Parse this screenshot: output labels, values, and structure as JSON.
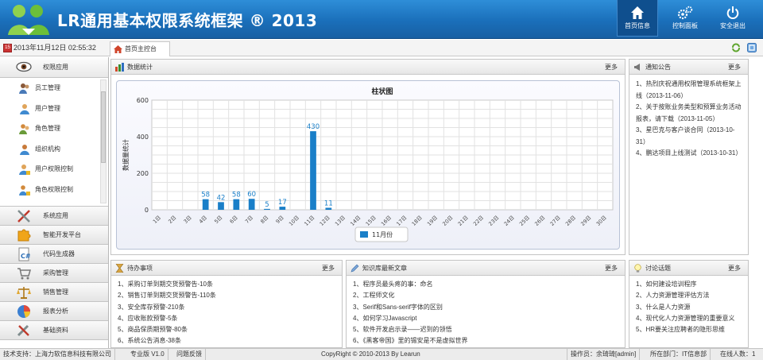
{
  "app": {
    "title": "LR通用基本权限系统框架 ® 2013",
    "colors": {
      "header": "#1a6fba",
      "accent": "#1f7fc7",
      "bar": "#1a7fc8"
    }
  },
  "header_buttons": [
    {
      "label": "首页信息",
      "icon": "home-icon"
    },
    {
      "label": "控制面板",
      "icon": "gears-icon"
    },
    {
      "label": "安全退出",
      "icon": "power-icon"
    }
  ],
  "datetime": "2013年11月12日 02:55:32",
  "date_icon_text": "15",
  "home_tab": "首页主控台",
  "sidebar": {
    "open_section": "权限应用",
    "open_items": [
      {
        "label": "员工管理",
        "icon": "employee-icon"
      },
      {
        "label": "用户管理",
        "icon": "user-icon"
      },
      {
        "label": "角色管理",
        "icon": "role-icon"
      },
      {
        "label": "组织机构",
        "icon": "org-icon"
      },
      {
        "label": "用户权限控制",
        "icon": "user-permission-icon"
      },
      {
        "label": "角色权限控制",
        "icon": "role-permission-icon"
      }
    ],
    "sections": [
      {
        "label": "系统应用",
        "icon": "tools-icon"
      },
      {
        "label": "智能开发平台",
        "icon": "puzzle-icon"
      },
      {
        "label": "代码生成器",
        "icon": "code-file-icon"
      },
      {
        "label": "采购管理",
        "icon": "cart-icon"
      },
      {
        "label": "销售管理",
        "icon": "scale-icon"
      },
      {
        "label": "报表分析",
        "icon": "pie-chart-icon"
      },
      {
        "label": "基础资料",
        "icon": "wrench-icon"
      }
    ]
  },
  "panels": {
    "stats": {
      "title": "数据统计",
      "more": "更多"
    },
    "notice": {
      "title": "通知公告",
      "more": "更多",
      "items": [
        "1、热烈庆祝通用权限管理系统框架上线（2013-11-06）",
        "2、关于按账业务类型和预算业务活动 报表，请下载（2013-11-05）",
        "3、星巴克与客户谈合同（2013-10-31）",
        "4、鹏达项目上线测试（2013-10-31）"
      ]
    },
    "todo": {
      "title": "待办事项",
      "more": "更多",
      "items": [
        "1、采购订单到期交货预警告-10条",
        "2、销售订单到期交货预警告-110条",
        "3、安全库存预警-210条",
        "4、应收账款预警-5条",
        "5、商品保质期预警-80条",
        "6、系统公告消息-38条"
      ]
    },
    "kb": {
      "title": "知识库最新文章",
      "more": "更多",
      "items": [
        "1、程序员最头疼的事：命名",
        "2、工程师文化",
        "3、Serif和Sans-serif字体的区别",
        "4、如何学习Javascript",
        "5、软件开发启示录——迟到的领悟",
        "6、《黑客帝国》里的锡安是不是虚拟世界"
      ]
    },
    "discuss": {
      "title": "讨论话题",
      "more": "更多",
      "items": [
        "1、如何建设培训程序",
        "2、人力资源管理评估方法",
        "3、什么是人力资源",
        "4、现代化人力资源管理的重要意义",
        "5、HR要关注应聘者的隐形思维"
      ]
    }
  },
  "chart_data": {
    "type": "bar",
    "title": "柱状图",
    "ylabel": "数据量统计",
    "ylim": [
      0,
      600
    ],
    "yticks": [
      0,
      200,
      400,
      600
    ],
    "categories": [
      "1日",
      "2日",
      "3日",
      "4日",
      "5日",
      "6日",
      "7日",
      "8日",
      "9日",
      "10日",
      "11日",
      "12日",
      "13日",
      "14日",
      "15日",
      "16日",
      "17日",
      "18日",
      "19日",
      "20日",
      "21日",
      "22日",
      "23日",
      "24日",
      "25日",
      "26日",
      "27日",
      "28日",
      "29日",
      "30日"
    ],
    "series": [
      {
        "name": "11月份",
        "values": [
          0,
          0,
          0,
          58,
          42,
          58,
          60,
          5,
          17,
          0,
          430,
          11,
          0,
          0,
          0,
          0,
          0,
          0,
          0,
          0,
          0,
          0,
          0,
          0,
          0,
          0,
          0,
          0,
          0,
          0
        ]
      }
    ],
    "grid": true,
    "legend": "bottom"
  },
  "footer": {
    "tech": "技术支持：上海力软信息科技有限公司",
    "edition": "专业版 V1.0",
    "feedback": "问题反馈",
    "copyright": "CopyRight © 2010-2013 By Learun",
    "operator": "操作员：余琦琦[admin]",
    "dept": "所在部门：IT信息部",
    "online": "在线人数：1"
  }
}
